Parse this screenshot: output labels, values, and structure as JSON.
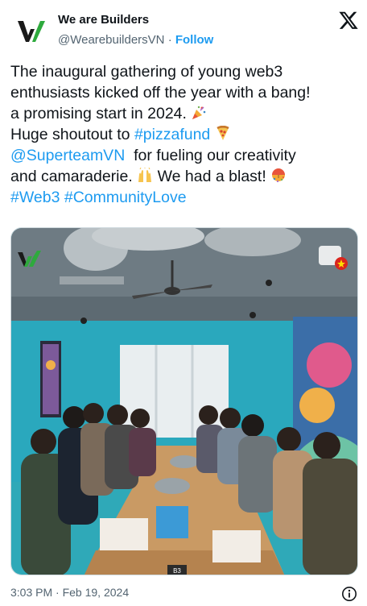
{
  "account": {
    "display_name": "We are Builders",
    "handle": "@WearebuildersVN",
    "separator": "·",
    "follow_label": "Follow"
  },
  "tweet": {
    "l1": "The inaugural gathering of young web3",
    "l2": "enthusiasts kicked off the year with a bang!",
    "l3": "a promising start in 2024.",
    "l4_text": "Huge shoutout to ",
    "l4_tag": "#pizzafund",
    "l5_mention": "@SuperteamVN",
    "l5_text": "  for fueling our creativity",
    "l6_text": "and camaraderie.",
    "l6_text2": " We had a blast!",
    "hashtag1": "#Web3",
    "hashtag2": "#CommunityLove"
  },
  "media": {
    "room_label": "B3"
  },
  "footer": {
    "time": "3:03 PM",
    "separator": "·",
    "date": "Feb 19, 2024"
  },
  "icons": {
    "x_logo": "x-logo-icon",
    "info": "info-icon",
    "party": "party-popper-icon",
    "pizza": "pizza-icon",
    "hands": "raising-hands-icon",
    "confetti": "confetti-ball-icon"
  },
  "colors": {
    "link": "#1d9bf0",
    "text": "#0f1419",
    "muted": "#536471"
  }
}
